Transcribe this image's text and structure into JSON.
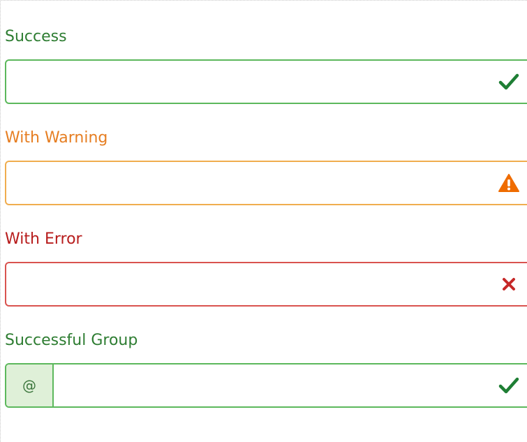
{
  "success": {
    "label": "Success",
    "value": "",
    "icon": "checkmark-icon",
    "color": "#2e7d32",
    "border_color": "#5cb85c"
  },
  "warning": {
    "label": "With Warning",
    "value": "",
    "icon": "warning-triangle-icon",
    "color": "#e67e22",
    "border_color": "#f0ad4e"
  },
  "error": {
    "label": "With Error",
    "value": "",
    "icon": "x-mark-icon",
    "color": "#b71c1c",
    "border_color": "#d9534f"
  },
  "successful_group": {
    "label": "Successful Group",
    "addon": "@",
    "value": "",
    "icon": "checkmark-icon",
    "color": "#2e7d32",
    "border_color": "#5cb85c"
  }
}
